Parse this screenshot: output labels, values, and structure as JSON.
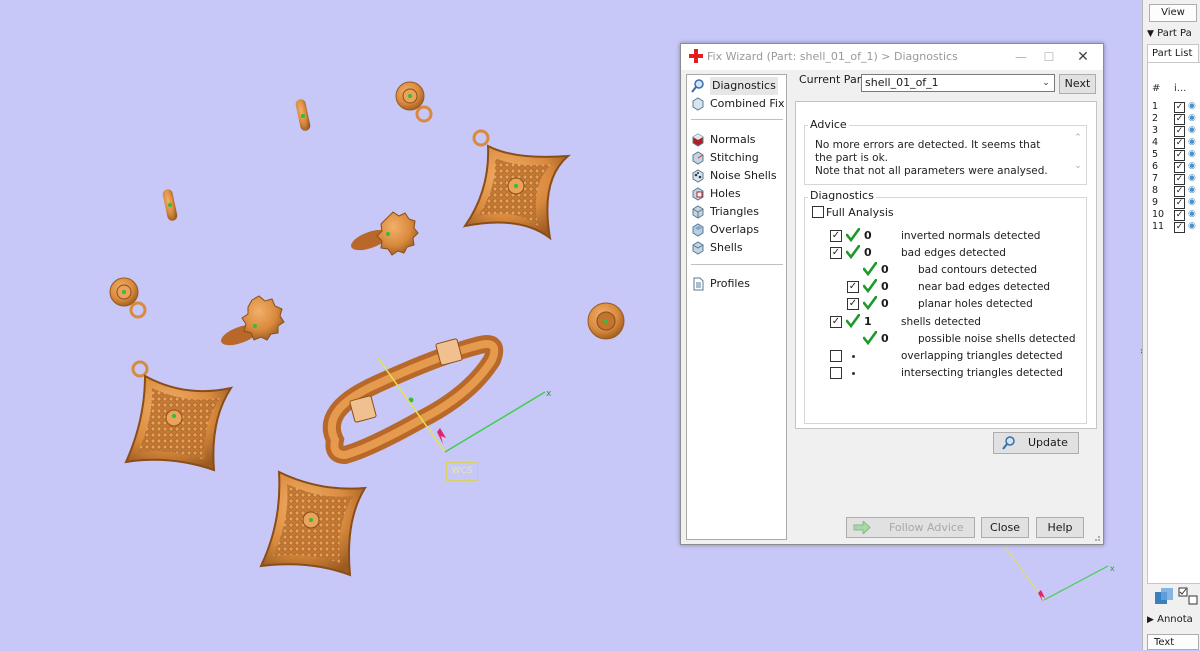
{
  "viewport": {
    "coord_label": "WCS",
    "axis_label": "x"
  },
  "right_panel": {
    "view_button": "View",
    "part_pages": "Part Pa",
    "part_list_tab": "Part List",
    "list_header_hash": "#",
    "list_header_col2": "i...",
    "rows": [
      "1",
      "2",
      "3",
      "4",
      "5",
      "6",
      "7",
      "8",
      "9",
      "10",
      "11"
    ],
    "annotations": "Annota",
    "text_button": "Text"
  },
  "dialog": {
    "title": "Fix Wizard (Part: shell_01_of_1) > Diagnostics",
    "current_part_label": "Current Part:",
    "current_part_value": "shell_01_of_1",
    "next_button": "Next",
    "nav": {
      "diagnostics": "Diagnostics",
      "combined_fix": "Combined Fix",
      "normals": "Normals",
      "stitching": "Stitching",
      "noise_shells": "Noise Shells",
      "holes": "Holes",
      "triangles": "Triangles",
      "overlaps": "Overlaps",
      "shells": "Shells",
      "profiles": "Profiles"
    },
    "advice": {
      "title": "Advice",
      "line1": "No more errors are detected. It seems that the part is ok.",
      "line2": "Note that not all parameters were analysed."
    },
    "diagnostics": {
      "title": "Diagnostics",
      "full_analysis": "Full Analysis",
      "rows": [
        {
          "count": "0",
          "text": "inverted normals detected"
        },
        {
          "count": "0",
          "text": "bad edges detected"
        },
        {
          "count": "0",
          "text": "bad contours detected"
        },
        {
          "count": "0",
          "text": "near bad edges detected"
        },
        {
          "count": "0",
          "text": "planar holes detected"
        },
        {
          "count": "1",
          "text": "shells detected"
        },
        {
          "count": "0",
          "text": "possible noise shells detected"
        },
        {
          "count": "",
          "text": "overlapping triangles detected"
        },
        {
          "count": "",
          "text": "intersecting triangles detected"
        }
      ],
      "update_button": "Update"
    },
    "follow_advice_button": "Follow Advice",
    "close_button": "Close",
    "help_button": "Help"
  },
  "colors": {
    "viewport_bg": "#c7c7f8",
    "part_orange": "#d98a3e",
    "check_green": "#1d9a2a"
  }
}
